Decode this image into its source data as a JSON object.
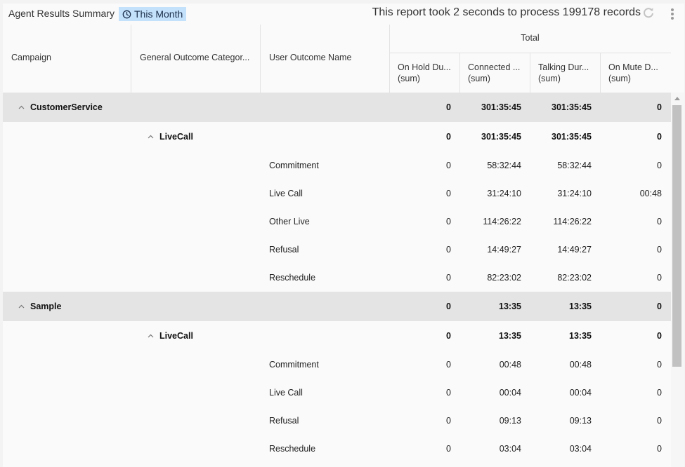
{
  "header": {
    "title": "Agent Results Summary",
    "period": "This Month",
    "process_text": "This report took 2 seconds to process 199178 records"
  },
  "icons": {
    "period": "clock-icon",
    "refresh": "refresh-icon",
    "menu": "more-vertical-icon",
    "collapse": "chevron-up-icon",
    "scroll_up": "arrow-up-icon"
  },
  "colors": {
    "period_badge": "#c4e1fb",
    "group_row": "#e4e4e4",
    "scroll_thumb": "#c1c1c1"
  },
  "table": {
    "headers": {
      "campaign": "Campaign",
      "category": "General Outcome Category",
      "category_display": "General Outcome Categor...",
      "outcome": "User Outcome Name",
      "group": "Total",
      "metrics": [
        {
          "display": "On Hold Du...",
          "sub": "(sum)"
        },
        {
          "display": "Connected ...",
          "sub": "(sum)"
        },
        {
          "display": "Talking Dur...",
          "sub": "(sum)"
        },
        {
          "display": "On Mute D...",
          "sub": "(sum)"
        }
      ]
    },
    "rows": [
      {
        "level": "campaign",
        "label": "CustomerService",
        "values": [
          "0",
          "301:35:45",
          "301:35:45",
          "0"
        ]
      },
      {
        "level": "category",
        "label": "LiveCall",
        "values": [
          "0",
          "301:35:45",
          "301:35:45",
          "0"
        ]
      },
      {
        "level": "outcome",
        "label": "Commitment",
        "values": [
          "0",
          "58:32:44",
          "58:32:44",
          "0"
        ]
      },
      {
        "level": "outcome",
        "label": "Live Call",
        "values": [
          "0",
          "31:24:10",
          "31:24:10",
          "00:48"
        ]
      },
      {
        "level": "outcome",
        "label": "Other Live",
        "values": [
          "0",
          "114:26:22",
          "114:26:22",
          "0"
        ]
      },
      {
        "level": "outcome",
        "label": "Refusal",
        "values": [
          "0",
          "14:49:27",
          "14:49:27",
          "0"
        ]
      },
      {
        "level": "outcome",
        "label": "Reschedule",
        "values": [
          "0",
          "82:23:02",
          "82:23:02",
          "0"
        ]
      },
      {
        "level": "campaign",
        "label": "Sample",
        "values": [
          "0",
          "13:35",
          "13:35",
          "0"
        ]
      },
      {
        "level": "category",
        "label": "LiveCall",
        "values": [
          "0",
          "13:35",
          "13:35",
          "0"
        ]
      },
      {
        "level": "outcome",
        "label": "Commitment",
        "values": [
          "0",
          "00:48",
          "00:48",
          "0"
        ]
      },
      {
        "level": "outcome",
        "label": "Live Call",
        "values": [
          "0",
          "00:04",
          "00:04",
          "0"
        ]
      },
      {
        "level": "outcome",
        "label": "Refusal",
        "values": [
          "0",
          "09:13",
          "09:13",
          "0"
        ]
      },
      {
        "level": "outcome",
        "label": "Reschedule",
        "values": [
          "0",
          "03:04",
          "03:04",
          "0"
        ]
      }
    ]
  }
}
